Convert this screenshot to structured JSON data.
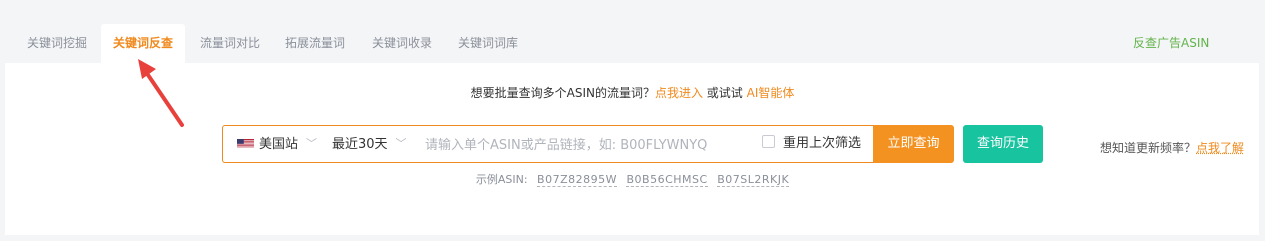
{
  "tabs": [
    {
      "label": "关键词挖掘",
      "active": false
    },
    {
      "label": "关键词反查",
      "active": true
    },
    {
      "label": "流量词对比",
      "active": false
    },
    {
      "label": "拓展流量词",
      "active": false
    },
    {
      "label": "关键词收录",
      "active": false
    },
    {
      "label": "关键词词库",
      "active": false
    }
  ],
  "header": {
    "ad_asin_link": "反查广告ASIN"
  },
  "promo": {
    "prefix": "想要批量查询多个ASIN的流量词？",
    "enter_link": "点我进入",
    "middle": " 或试试 ",
    "ai_link": "AI智能体"
  },
  "search": {
    "site": "美国站",
    "site_flag": "us-flag-icon",
    "period": "最近30天",
    "input_value": "",
    "input_placeholder": "请输入单个ASIN或产品链接，如: B00FLYWNYQ",
    "reuse_label": "重用上次筛选",
    "reuse_checked": false,
    "submit_label": "立即查询",
    "history_label": "查询历史"
  },
  "freq": {
    "prefix": "想知道更新频率？",
    "link": "点我了解"
  },
  "examples": {
    "label": "示例ASIN:",
    "asins": [
      "B07Z82895W",
      "B0B56CHMSC",
      "B07SL2RKJK"
    ]
  },
  "colors": {
    "accent": "#f08a1e",
    "ad_link": "#62b34a",
    "history_button": "#18c3a0",
    "annotation_arrow": "#e8413c"
  }
}
